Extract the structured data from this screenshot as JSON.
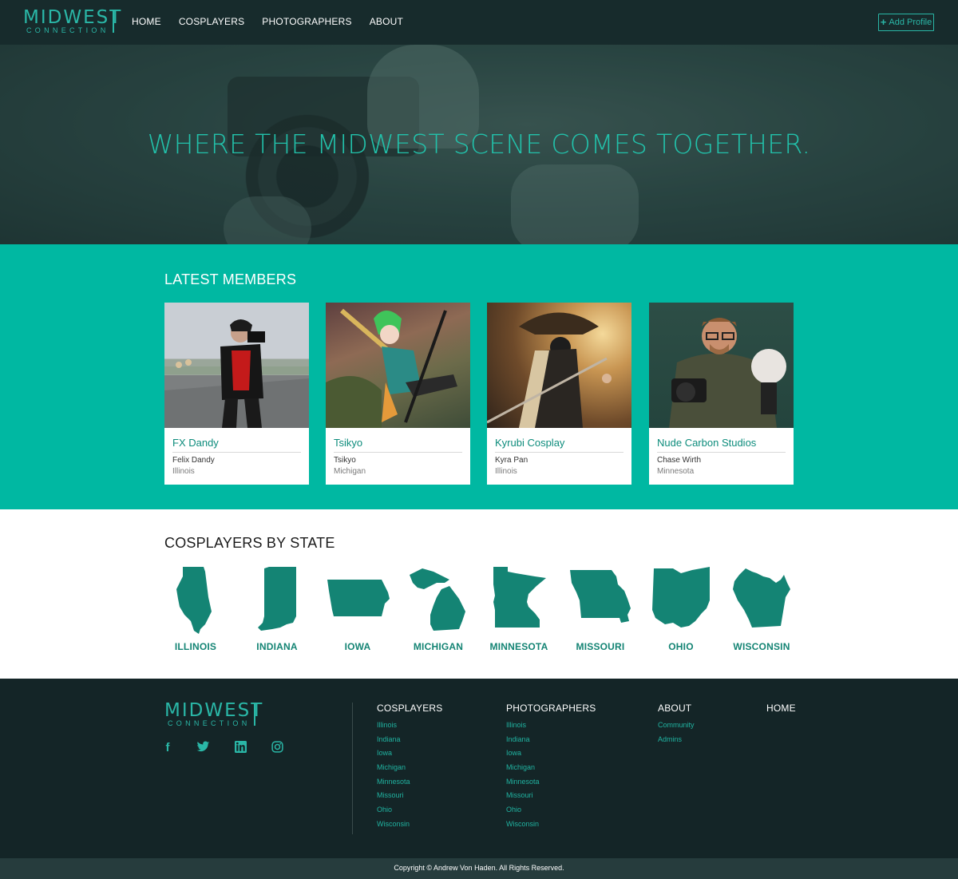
{
  "brand": {
    "logo_main": "MIDWEST",
    "logo_sub": "CONNECTION"
  },
  "nav": {
    "items": [
      "HOME",
      "COSPLAYERS",
      "PHOTOGRAPHERS",
      "ABOUT"
    ],
    "add_profile": "Add Profile",
    "add_icon": "plus-icon"
  },
  "hero": {
    "headline": "WHERE THE MIDWEST SCENE COMES TOGETHER."
  },
  "latest": {
    "title": "LATEST MEMBERS",
    "members": [
      {
        "handle": "FX Dandy",
        "name": "Felix Dandy",
        "state": "Illinois"
      },
      {
        "handle": "Tsikyo",
        "name": "Tsikyo",
        "state": "Michigan"
      },
      {
        "handle": "Kyrubi Cosplay",
        "name": "Kyra Pan",
        "state": "Illinois"
      },
      {
        "handle": "Nude Carbon Studios",
        "name": "Chase Wirth",
        "state": "Minnesota"
      }
    ]
  },
  "states_section": {
    "title": "COSPLAYERS BY STATE",
    "states": [
      "ILLINOIS",
      "INDIANA",
      "IOWA",
      "MICHIGAN",
      "MINNESOTA",
      "MISSOURI",
      "OHIO",
      "WISCONSIN"
    ],
    "color": "#148474"
  },
  "footer": {
    "social": [
      "facebook-icon",
      "twitter-icon",
      "linkedin-icon",
      "instagram-icon"
    ],
    "cosplayers": {
      "heading": "COSPLAYERS",
      "links": [
        "Illinois",
        "Indiana",
        "Iowa",
        "Michigan",
        "Minnesota",
        "Missouri",
        "Ohio",
        "Wisconsin"
      ]
    },
    "photographers": {
      "heading": "PHOTOGRAPHERS",
      "links": [
        "Illinois",
        "Indiana",
        "Iowa",
        "Michigan",
        "Minnesota",
        "Missouri",
        "Ohio",
        "Wisconsin"
      ]
    },
    "about": {
      "heading": "ABOUT",
      "links": [
        "Community",
        "Admins"
      ]
    },
    "home": {
      "heading": "HOME"
    },
    "copyright": "Copyright © Andrew Von Haden. All Rights Reserved."
  },
  "colors": {
    "accent": "#2ab7a7",
    "teal_band": "#00b8a2",
    "dark": "#172b2c"
  }
}
